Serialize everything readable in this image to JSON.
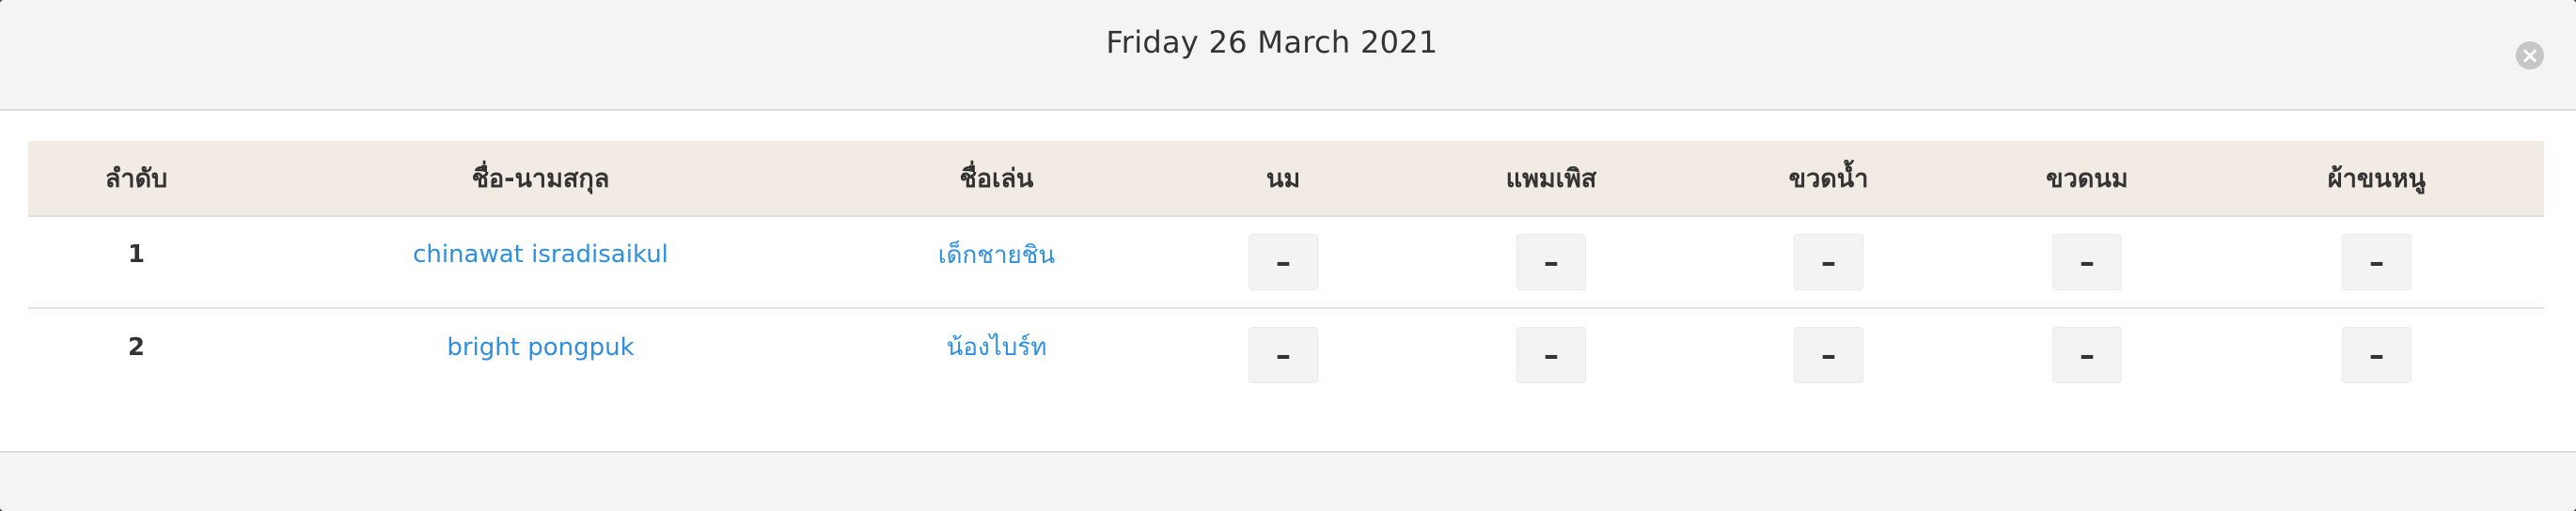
{
  "modal": {
    "title": "Friday 26 March 2021",
    "close_icon": "close-icon"
  },
  "table": {
    "headers": [
      "ลำดับ",
      "ชื่อ-นามสกุล",
      "ชื่อเล่น",
      "นม",
      "แพมเพิส",
      "ขวดน้ำ",
      "ขวดนม",
      "ผ้าขนหนู"
    ],
    "rows": [
      {
        "index": "1",
        "name": "chinawat isradisaikul",
        "nickname": "เด็กชายชิน",
        "milk": "–",
        "diaper": "–",
        "water_bottle": "–",
        "milk_bottle": "–",
        "towel": "–"
      },
      {
        "index": "2",
        "name": "bright pongpuk",
        "nickname": "น้องไบร์ท",
        "milk": "–",
        "diaper": "–",
        "water_bottle": "–",
        "milk_bottle": "–",
        "towel": "–"
      }
    ]
  },
  "colors": {
    "link": "#2f8fe0",
    "header_bg": "#f1ebe4",
    "modal_header_bg": "#f4f4f4"
  }
}
